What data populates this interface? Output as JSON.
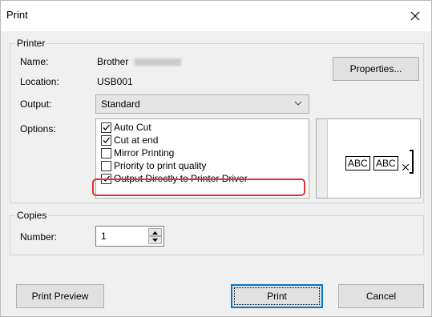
{
  "window": {
    "title": "Print",
    "close_glyph": "✕"
  },
  "printer": {
    "group_label": "Printer",
    "name_label": "Name:",
    "name_value": "Brother",
    "location_label": "Location:",
    "location_value": "USB001",
    "properties_button": "Properties...",
    "output_label": "Output:",
    "output_value": "Standard",
    "options_label": "Options:",
    "options": [
      {
        "label": "Auto Cut",
        "checked": true
      },
      {
        "label": "Cut at end",
        "checked": true
      },
      {
        "label": "Mirror Printing",
        "checked": false
      },
      {
        "label": "Priority to print quality",
        "checked": false
      },
      {
        "label": "Output Directly to Printer Driver",
        "checked": true
      }
    ],
    "preview_labels": [
      "ABC",
      "ABC"
    ]
  },
  "copies": {
    "group_label": "Copies",
    "number_label": "Number:",
    "number_value": "1"
  },
  "buttons": {
    "print_preview": "Print Preview",
    "print": "Print",
    "cancel": "Cancel"
  },
  "colors": {
    "highlight": "#e0302f",
    "focus": "#0078d7"
  }
}
